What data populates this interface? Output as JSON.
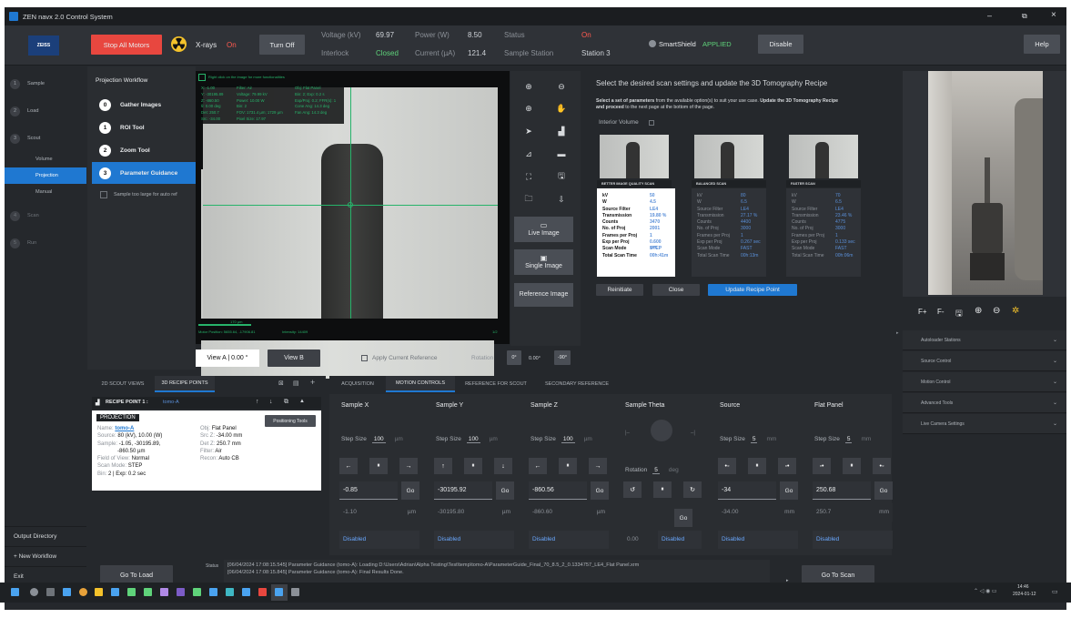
{
  "window": {
    "title": "ZEN navx 2.0 Control System",
    "min": "–",
    "max": "⧉",
    "close": "×"
  },
  "header": {
    "logo": "ZEISS",
    "stop_all": "Stop All Motors",
    "xrays_label": "X-rays",
    "xrays_state": "On",
    "turn_off": "Turn Off",
    "voltage_label": "Voltage (kV)",
    "voltage_value": "69.97",
    "power_label": "Power (W)",
    "power_value": "8.50",
    "interlock_label": "Interlock",
    "interlock_value": "Closed",
    "current_label": "Current (µA)",
    "current_value": "121.4",
    "status_label": "Status",
    "status_value": "On",
    "sample_station_label": "Sample Station",
    "sample_station_value": "Station 3",
    "smartshield_label": "SmartShield",
    "smartshield_value": "APPLIED",
    "disable": "Disable",
    "help": "Help"
  },
  "sidebar": {
    "items": [
      {
        "num": "1",
        "label": "Sample"
      },
      {
        "num": "2",
        "label": "Load"
      },
      {
        "num": "3",
        "label": "Scout"
      }
    ],
    "subitems": [
      "Volume",
      "Projection",
      "Manual"
    ],
    "items2": [
      {
        "num": "4",
        "label": "Scan"
      },
      {
        "num": "5",
        "label": "Run"
      }
    ],
    "output_directory": "Output Directory",
    "new_workflow": "+ New Workflow",
    "exit": "Exit"
  },
  "workflow": {
    "title": "Projection Workflow",
    "steps": [
      {
        "num": "0",
        "label": "Gather Images"
      },
      {
        "num": "1",
        "label": "ROI Tool"
      },
      {
        "num": "2",
        "label": "Zoom Tool"
      },
      {
        "num": "3",
        "label": "Parameter Guidance"
      }
    ],
    "checkbox": "Sample too large for auto ref"
  },
  "viewer": {
    "hint": "Right click on the image for more functionalities",
    "scalebar": "170 µm",
    "info_left": [
      "X: -1.00",
      "Y: -30195.89",
      "Z: -860.50",
      "θ: 0.00 deg",
      "Det: 250.7",
      "Src: -34.00"
    ],
    "info_mid": [
      "Filter: Air",
      "Voltage: 79.99 kV",
      "Power: 10.00 W",
      "Bin: 2",
      "FOV: 1731.4 µm; 1729 µm",
      "Pixel Size: 17.97"
    ],
    "info_right": [
      "Obj: Flat Panel",
      "Bin: 2; Exp: 0.2 s",
      "Exp/Proj: 0.2; FFR(s): 1",
      "Cone Ang: 14.3 deg",
      "Fan Ang: 14.3 deg"
    ],
    "motor_text": "Motor Position: 5655.64, -17906.81",
    "intensity": "Intensity: 14409",
    "frame": "1/2",
    "view_a": "View A | 0.00 °",
    "view_b": "View B",
    "apply_ref": "Apply Current Reference",
    "rotation": "Rotation",
    "rot0": "0°",
    "rot_val": "0.00°",
    "rotm90": "-90°"
  },
  "tools": {
    "zoom_in": "⊕",
    "zoom_out": "⊖",
    "zoom_fit": "⊕",
    "pan": "✋",
    "pointer": "➤",
    "histogram": "▟",
    "plot": "⊿",
    "line": "▬",
    "crop": "⛶",
    "save": "🖫",
    "folder": "🗀",
    "export": "⇩",
    "live_image": "Live Image",
    "single_image": "Single Image",
    "reference_image": "Reference Image"
  },
  "recipe": {
    "heading": "Select the desired scan settings and update the 3D Tomography Recipe",
    "subtext_bold1": "Select a set of parameters",
    "subtext1": " from the available option(s) to suit your use case. ",
    "subtext_bold2": "Update the 3D Tomography Recipe and proceed",
    "subtext2": " to the next page at the bottom of the page.",
    "interior_volume": "Interior Volume",
    "cards": [
      {
        "title": "BETTER IMAGE QUALITY SCAN",
        "selected": true,
        "rows": [
          [
            "kV",
            "50"
          ],
          [
            "W",
            "4.5"
          ],
          [
            "Source Filter",
            "LE4"
          ],
          [
            "Transmission",
            "19.80 %"
          ],
          [
            "Counts",
            "3470"
          ],
          [
            "No. of Proj",
            "2001"
          ],
          [
            "Frames per Proj",
            "1"
          ],
          [
            "Exp per Proj",
            "0.600 sec"
          ],
          [
            "Scan Mode",
            "STEP"
          ],
          [
            "Total Scan Time",
            "00h:41m"
          ]
        ]
      },
      {
        "title": "BALANCED SCAN",
        "selected": false,
        "rows": [
          [
            "kV",
            "80"
          ],
          [
            "W",
            "6.5"
          ],
          [
            "Source Filter",
            "LE4"
          ],
          [
            "Transmission",
            "27.17 %"
          ],
          [
            "Counts",
            "4400"
          ],
          [
            "No. of Proj",
            "3000"
          ],
          [
            "Frames per Proj",
            "1"
          ],
          [
            "Exp per Proj",
            "0.267 sec"
          ],
          [
            "Scan Mode",
            "FAST"
          ],
          [
            "Total Scan Time",
            "00h:13m"
          ]
        ]
      },
      {
        "title": "FASTER SCAN",
        "selected": false,
        "rows": [
          [
            "kV",
            "70"
          ],
          [
            "W",
            "6.5"
          ],
          [
            "Source Filter",
            "LE4"
          ],
          [
            "Transmission",
            "23.46 %"
          ],
          [
            "Counts",
            "4775"
          ],
          [
            "No. of Proj",
            "3000"
          ],
          [
            "Frames per Proj",
            "1"
          ],
          [
            "Exp per Proj",
            "0.133 sec"
          ],
          [
            "Scan Mode",
            "FAST"
          ],
          [
            "Total Scan Time",
            "00h:06m"
          ]
        ]
      }
    ],
    "reinitiate": "Reinitiate",
    "close": "Close",
    "update": "Update Recipe Point"
  },
  "camera": {
    "controls": [
      "F+",
      "F-",
      "🖫",
      "⊕",
      "⊖",
      "✲"
    ]
  },
  "right_sections": [
    "Autoloader Stations",
    "Source Control",
    "Motion Control",
    "Advanced Tools",
    "Live Camera Settings"
  ],
  "recipe_panel": {
    "tab1": "2D SCOUT VIEWS",
    "tab2": "3D RECIPE POINTS",
    "rp_label": "RECIPE POINT 1 :",
    "rp_name": "tomo-A",
    "projection": "PROJECTION",
    "positioning": "Positioning Tools",
    "left": [
      [
        "Name:",
        "tomo-A"
      ],
      [
        "Source:",
        "80 (kV), 10.00 (W)"
      ],
      [
        "Sample:",
        "-1.05, -30195.89,"
      ],
      [
        "",
        "-860.50 µm"
      ],
      [
        "Field of View:",
        "Normal"
      ],
      [
        "Scan Mode:",
        "STEP"
      ],
      [
        "Bin:",
        "2 | Exp: 0.2 sec"
      ]
    ],
    "right": [
      [
        "Obj:",
        "Flat Panel"
      ],
      [
        "Src Z:",
        "-34.00 mm"
      ],
      [
        "Det Z:",
        "250.7 mm"
      ],
      [
        "Filter:",
        "Air"
      ],
      [
        "Recon:",
        "Auto CB"
      ]
    ]
  },
  "motion": {
    "tabs": [
      "ACQUISITION",
      "MOTION CONTROLS",
      "REFERENCE FOR SCOUT",
      "SECONDARY REFERENCE"
    ],
    "step_size": "Step Size",
    "go": "Go",
    "disabled": "Disabled",
    "cols": [
      {
        "title": "Sample X",
        "step": "100",
        "unit": "µm",
        "value": "-0.85",
        "readout": "-1.10"
      },
      {
        "title": "Sample Y",
        "step": "100",
        "unit": "µm",
        "value": "-30195.92",
        "readout": "-30195.80"
      },
      {
        "title": "Sample Z",
        "step": "100",
        "unit": "µm",
        "value": "-860.56",
        "readout": "-860.60"
      },
      {
        "title": "Sample Theta",
        "step": "5",
        "unit": "deg",
        "value": "",
        "readout": "0.00"
      },
      {
        "title": "Source",
        "step": "5",
        "unit": "mm",
        "value": "-34",
        "readout": "-34.00"
      },
      {
        "title": "Flat Panel",
        "step": "5",
        "unit": "mm",
        "value": "250.68",
        "readout": "250.7"
      }
    ],
    "rotation": "Rotation"
  },
  "status": {
    "goto_load": "Go To Load",
    "label": "Status",
    "line1": "[06/04/2024 17:08:15.545] Parameter Guidance (tomo-A): Loading D:\\Users\\Adrian\\Alpha Testing\\Test\\temp\\tomo-A\\ParameterGuide_Final_70_8.5_2_0.1334757_LE4_Flat Panel.xrm",
    "line2": "[06/04/2024 17:08:15.845] Parameter Guidance (tomo-A): Final Results Done.",
    "goto_scan": "Go To Scan"
  },
  "taskbar": {
    "time": "14:46",
    "date": "2024-01-12"
  },
  "colors": {
    "accent": "#1f78d1",
    "stop": "#e8473f",
    "green": "#5fd37a"
  }
}
